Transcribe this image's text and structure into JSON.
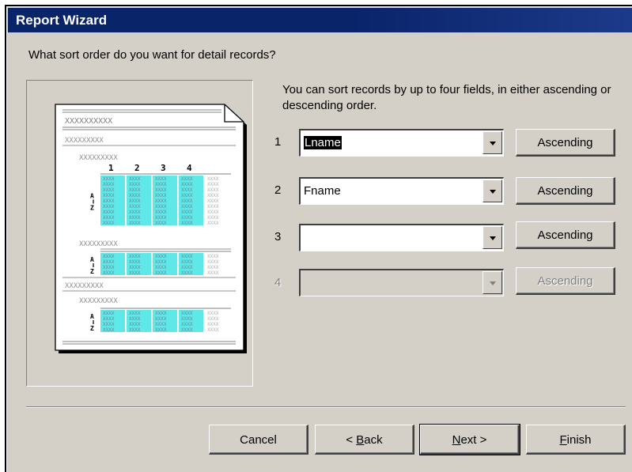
{
  "window": {
    "title": "Report Wizard"
  },
  "question": "What sort order do you want for detail records?",
  "info": "You can sort records by up to four fields, in either ascending or descending order.",
  "sort_rows": [
    {
      "number": "1",
      "field": "Lname",
      "order": "Ascending",
      "enabled": true,
      "selected": true
    },
    {
      "number": "2",
      "field": "Fname",
      "order": "Ascending",
      "enabled": true,
      "selected": false
    },
    {
      "number": "3",
      "field": "",
      "order": "Ascending",
      "enabled": true,
      "selected": false
    },
    {
      "number": "4",
      "field": "",
      "order": "Ascending",
      "enabled": false,
      "selected": false
    }
  ],
  "preview": {
    "placeholder_long": "XXXXXXXXXX",
    "placeholder_mid": "XXXXXXXXX",
    "cell_text": "XXXX",
    "column_numbers": [
      "1",
      "2",
      "3",
      "4"
    ],
    "sort_glyph_top": "A",
    "sort_glyph_bottom": "Z",
    "highlight_color": "#5ee8e8"
  },
  "buttons": {
    "cancel": "Cancel",
    "back_prefix": "< ",
    "back_mnemonic": "B",
    "back_rest": "ack",
    "next_mnemonic": "N",
    "next_rest": "ext >",
    "finish_mnemonic": "F",
    "finish_rest": "inish"
  }
}
